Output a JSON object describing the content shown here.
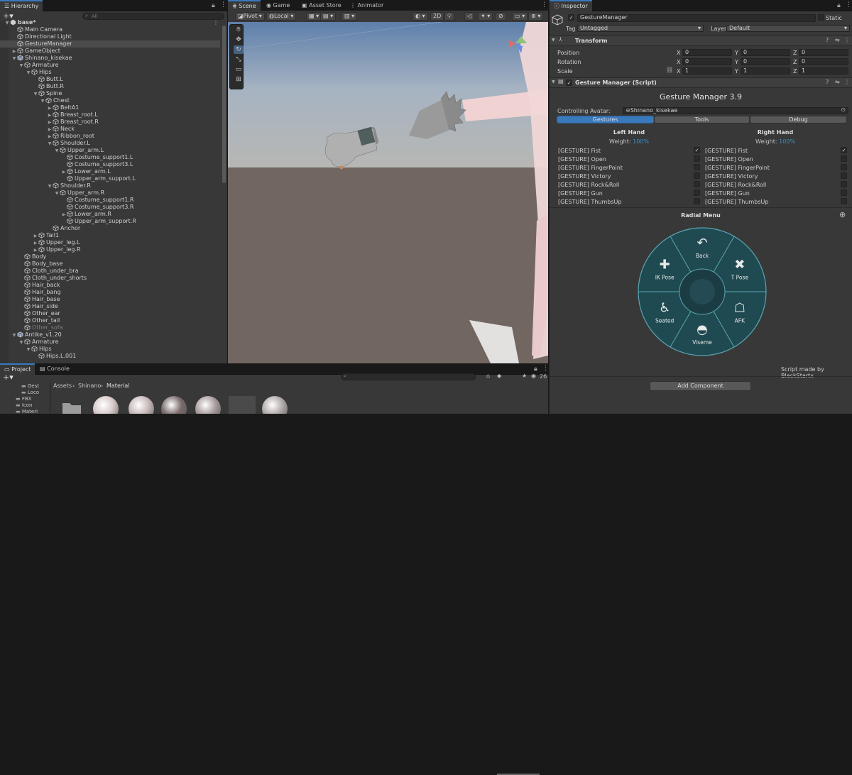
{
  "hierarchy": {
    "tab": "Hierarchy",
    "search_placeholder": "All",
    "rows": [
      {
        "label": "base*",
        "depth": 0,
        "arrow": "▼",
        "icon": "unity-scene-icon",
        "bold": true
      },
      {
        "label": "Main Camera",
        "depth": 1,
        "arrow": "",
        "icon": "cube-icon"
      },
      {
        "label": "Directional Light",
        "depth": 1,
        "arrow": "",
        "icon": "cube-icon"
      },
      {
        "label": "GestureManager",
        "depth": 1,
        "arrow": "",
        "icon": "cube-icon",
        "selected": true
      },
      {
        "label": "GameObject",
        "depth": 1,
        "arrow": "▶",
        "icon": "cube-icon"
      },
      {
        "label": "Shinano_kisekae",
        "depth": 1,
        "arrow": "▼",
        "icon": "prefab-icon"
      },
      {
        "label": "Armature",
        "depth": 2,
        "arrow": "▼",
        "icon": "cube-icon"
      },
      {
        "label": "Hips",
        "depth": 3,
        "arrow": "▼",
        "icon": "cube-icon"
      },
      {
        "label": "Butt.L",
        "depth": 4,
        "arrow": "",
        "icon": "cube-icon"
      },
      {
        "label": "Butt.R",
        "depth": 4,
        "arrow": "",
        "icon": "cube-icon"
      },
      {
        "label": "Spine",
        "depth": 4,
        "arrow": "▼",
        "icon": "cube-icon"
      },
      {
        "label": "Chest",
        "depth": 5,
        "arrow": "▼",
        "icon": "cube-icon"
      },
      {
        "label": "BeltA1",
        "depth": 6,
        "arrow": "▶",
        "icon": "cube-icon"
      },
      {
        "label": "Breast_root.L",
        "depth": 6,
        "arrow": "▶",
        "icon": "cube-icon"
      },
      {
        "label": "Breast_root.R",
        "depth": 6,
        "arrow": "▶",
        "icon": "cube-icon"
      },
      {
        "label": "Neck",
        "depth": 6,
        "arrow": "▶",
        "icon": "cube-icon"
      },
      {
        "label": "Ribbon_root",
        "depth": 6,
        "arrow": "▶",
        "icon": "cube-icon"
      },
      {
        "label": "Shoulder.L",
        "depth": 6,
        "arrow": "▼",
        "icon": "cube-icon"
      },
      {
        "label": "Upper_arm.L",
        "depth": 7,
        "arrow": "▼",
        "icon": "cube-icon"
      },
      {
        "label": "Costume_support1.L",
        "depth": 8,
        "arrow": "",
        "icon": "cube-icon"
      },
      {
        "label": "Costume_support3.L",
        "depth": 8,
        "arrow": "",
        "icon": "cube-icon"
      },
      {
        "label": "Lower_arm.L",
        "depth": 8,
        "arrow": "▶",
        "icon": "cube-icon"
      },
      {
        "label": "Upper_arm_support.L",
        "depth": 8,
        "arrow": "",
        "icon": "cube-icon"
      },
      {
        "label": "Shoulder.R",
        "depth": 6,
        "arrow": "▼",
        "icon": "cube-icon"
      },
      {
        "label": "Upper_arm.R",
        "depth": 7,
        "arrow": "▼",
        "icon": "cube-icon"
      },
      {
        "label": "Costume_support1.R",
        "depth": 8,
        "arrow": "",
        "icon": "cube-icon"
      },
      {
        "label": "Costume_support3.R",
        "depth": 8,
        "arrow": "",
        "icon": "cube-icon"
      },
      {
        "label": "Lower_arm.R",
        "depth": 8,
        "arrow": "▶",
        "icon": "cube-icon"
      },
      {
        "label": "Upper_arm_support.R",
        "depth": 8,
        "arrow": "",
        "icon": "cube-icon"
      },
      {
        "label": "Anchor",
        "depth": 6,
        "arrow": "",
        "icon": "cube-icon"
      },
      {
        "label": "Tail1",
        "depth": 4,
        "arrow": "▶",
        "icon": "cube-icon"
      },
      {
        "label": "Upper_leg.L",
        "depth": 4,
        "arrow": "▶",
        "icon": "cube-icon"
      },
      {
        "label": "Upper_leg.R",
        "depth": 4,
        "arrow": "▶",
        "icon": "cube-icon"
      },
      {
        "label": "Body",
        "depth": 2,
        "arrow": "",
        "icon": "cube-icon"
      },
      {
        "label": "Body_base",
        "depth": 2,
        "arrow": "",
        "icon": "cube-icon"
      },
      {
        "label": "Cloth_under_bra",
        "depth": 2,
        "arrow": "",
        "icon": "cube-icon"
      },
      {
        "label": "Cloth_under_shorts",
        "depth": 2,
        "arrow": "",
        "icon": "cube-icon"
      },
      {
        "label": "Hair_back",
        "depth": 2,
        "arrow": "",
        "icon": "cube-icon"
      },
      {
        "label": "Hair_bang",
        "depth": 2,
        "arrow": "",
        "icon": "cube-icon"
      },
      {
        "label": "Hair_base",
        "depth": 2,
        "arrow": "",
        "icon": "cube-icon"
      },
      {
        "label": "Hair_side",
        "depth": 2,
        "arrow": "",
        "icon": "cube-icon"
      },
      {
        "label": "Other_ear",
        "depth": 2,
        "arrow": "",
        "icon": "cube-icon"
      },
      {
        "label": "Other_tail",
        "depth": 2,
        "arrow": "",
        "icon": "cube-icon"
      },
      {
        "label": "Other_sofa",
        "depth": 2,
        "arrow": "",
        "icon": "cube-icon",
        "dim": true
      },
      {
        "label": "Antike_v1.20",
        "depth": 1,
        "arrow": "▼",
        "icon": "prefab-icon"
      },
      {
        "label": "Armature",
        "depth": 2,
        "arrow": "▼",
        "icon": "cube-icon"
      },
      {
        "label": "Hips",
        "depth": 3,
        "arrow": "▼",
        "icon": "cube-icon"
      },
      {
        "label": "Hips.L.001",
        "depth": 4,
        "arrow": "",
        "icon": "cube-icon"
      }
    ]
  },
  "scene": {
    "tabs": [
      "Scene",
      "Game",
      "Asset Store",
      "Animator"
    ],
    "pivot": "Pivot",
    "local": "Local",
    "mode_2d": "2D",
    "tools": [
      "hand-icon",
      "move-icon",
      "rotate-icon",
      "scale-icon",
      "rect-icon",
      "transform-icon"
    ]
  },
  "project": {
    "tabs": [
      "Project",
      "Console"
    ],
    "breadcrumb": [
      "Assets",
      "Shinano",
      "Material"
    ],
    "folders": [
      "Gest",
      "Loco",
      "FBX",
      "Icon",
      "Materi"
    ],
    "count": "26"
  },
  "inspector": {
    "tab": "Inspector",
    "object_name": "GestureManager",
    "static_label": "Static",
    "tag_label": "Tag",
    "tag_value": "Untagged",
    "layer_label": "Layer",
    "layer_value": "Default",
    "transform": {
      "title": "Transform",
      "rows": [
        {
          "label": "Position",
          "x": "0",
          "y": "0",
          "z": "0"
        },
        {
          "label": "Rotation",
          "x": "0",
          "y": "0",
          "z": "0"
        },
        {
          "label": "Scale",
          "x": "1",
          "y": "1",
          "z": "1"
        }
      ]
    },
    "gm": {
      "title": "Gesture Manager (Script)",
      "heading": "Gesture Manager 3.9",
      "controlling_label": "Controlling Avatar:",
      "controlling_value": "Shinano_kisekae",
      "tabs": [
        "Gestures",
        "Tools",
        "Debug"
      ],
      "left_hand": "Left Hand",
      "right_hand": "Right Hand",
      "weight_label": "Weight:",
      "weight_left": "100%",
      "weight_right": "100%",
      "gestures": [
        "[GESTURE] Fist",
        "[GESTURE] Open",
        "[GESTURE] FingerPoint",
        "[GESTURE] Victory",
        "[GESTURE] Rock&Roll",
        "[GESTURE] Gun",
        "[GESTURE] ThumbsUp"
      ],
      "left_checked": [
        true,
        false,
        false,
        false,
        false,
        false,
        false
      ],
      "right_checked": [
        true,
        false,
        false,
        false,
        false,
        false,
        false
      ],
      "radial_title": "Radial Menu",
      "radial_items": [
        "Back",
        "T Pose",
        "AFK",
        "Viseme",
        "Seated",
        "IK Pose"
      ],
      "credit": "Script made by BlackStartx",
      "add_component": "Add Component"
    }
  },
  "colors": {
    "accent": "#3a79bb",
    "panel": "#383838",
    "radial_fill": "#1f4a52",
    "radial_stroke": "#5aa6b1",
    "weight": "#3d8fc6"
  }
}
